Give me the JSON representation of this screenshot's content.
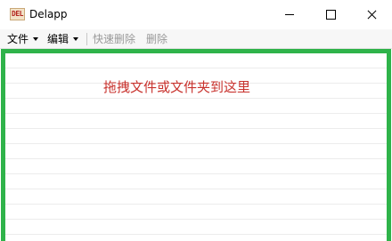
{
  "window": {
    "icon_text": "DEL",
    "title": "Delapp"
  },
  "toolbar": {
    "file_menu": "文件",
    "edit_menu": "编辑",
    "quick_delete": "快速删除",
    "delete": "删除"
  },
  "drop_area": {
    "hint": "拖拽文件或文件夹到这里",
    "border_color": "#2fb34a",
    "hint_color": "#c8322d"
  }
}
